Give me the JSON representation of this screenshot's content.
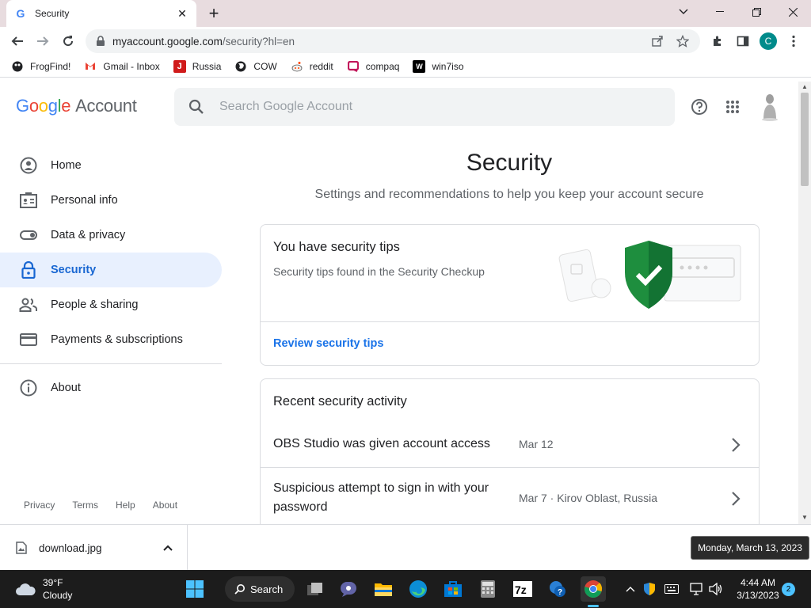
{
  "browser": {
    "tab_title": "Security",
    "new_tab_symbol": "+",
    "url_host": "myaccount.google.com",
    "url_path": "/security?hl=en",
    "profile_initial": "C",
    "bookmarks": [
      {
        "label": "FrogFind!",
        "icon": "frog-icon",
        "color": "#202124"
      },
      {
        "label": "Gmail - Inbox",
        "icon": "gmail-icon",
        "color": "#ea4335"
      },
      {
        "label": "Russia",
        "icon": "wiki-red-icon",
        "color": "#d01b1b"
      },
      {
        "label": "COW",
        "icon": "globe-icon",
        "color": "#202124"
      },
      {
        "label": "reddit",
        "icon": "reddit-icon",
        "color": "#ff4500"
      },
      {
        "label": "compaq",
        "icon": "compaq-icon",
        "color": "#c2185b"
      },
      {
        "label": "win7iso",
        "icon": "w-icon",
        "color": "#000000"
      }
    ]
  },
  "header": {
    "logo_letters": [
      "G",
      "o",
      "o",
      "g",
      "l",
      "e"
    ],
    "logo_colors": [
      "#4285f4",
      "#ea4335",
      "#fbbc05",
      "#4285f4",
      "#34a853",
      "#ea4335"
    ],
    "logo_suffix": "Account",
    "search_placeholder": "Search Google Account"
  },
  "sidebar": {
    "items": [
      {
        "label": "Home",
        "icon": "home-icon",
        "active": false
      },
      {
        "label": "Personal info",
        "icon": "id-card-icon",
        "active": false
      },
      {
        "label": "Data & privacy",
        "icon": "toggle-icon",
        "active": false
      },
      {
        "label": "Security",
        "icon": "lock-icon",
        "active": true
      },
      {
        "label": "People & sharing",
        "icon": "people-icon",
        "active": false
      },
      {
        "label": "Payments & subscriptions",
        "icon": "card-icon",
        "active": false
      }
    ],
    "about_label": "About",
    "footer_links": [
      "Privacy",
      "Terms",
      "Help",
      "About"
    ]
  },
  "main": {
    "title": "Security",
    "subtitle": "Settings and recommendations to help you keep your account secure",
    "tips_card": {
      "title": "You have security tips",
      "description": "Security tips found in the Security Checkup",
      "link": "Review security tips"
    },
    "activity_card": {
      "title": "Recent security activity",
      "rows": [
        {
          "text": "OBS Studio was given account access",
          "meta": "Mar 12"
        },
        {
          "text": "Suspicious attempt to sign in with your password",
          "meta": "Mar 7 · Kirov Oblast, Russia"
        }
      ]
    }
  },
  "downloads": {
    "file_name": "download.jpg"
  },
  "tooltip": "Monday, March 13, 2023",
  "taskbar": {
    "temperature": "39°F",
    "condition": "Cloudy",
    "search_label": "Search",
    "time": "4:44 AM",
    "date": "3/13/2023",
    "notification_count": "2"
  }
}
